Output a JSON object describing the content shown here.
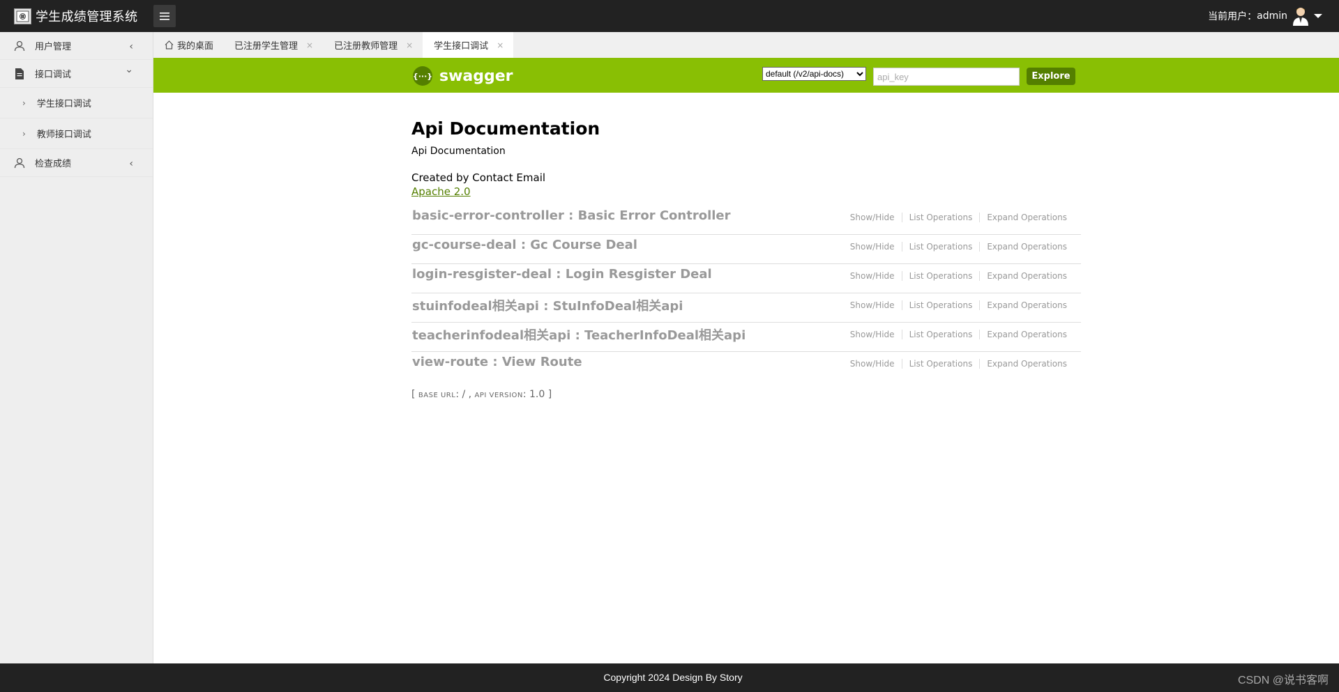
{
  "app": {
    "title": "学生成绩管理系统",
    "current_user_label": "当前用户：",
    "current_user": "admin"
  },
  "sidebar": {
    "items": [
      {
        "label": "用户管理",
        "icon": "user-icon",
        "chevron": "‹"
      },
      {
        "label": "接口调试",
        "icon": "document-icon",
        "chevron": "⌄",
        "children": [
          {
            "label": "学生接口调试"
          },
          {
            "label": "教师接口调试"
          }
        ]
      },
      {
        "label": "检查成绩",
        "icon": "user-icon",
        "chevron": "‹"
      }
    ]
  },
  "tabs": [
    {
      "label": "我的桌面",
      "icon": "home-icon"
    },
    {
      "label": "已注册学生管理",
      "close": "×"
    },
    {
      "label": "已注册教师管理",
      "close": "×"
    },
    {
      "label": "学生接口调试",
      "close": "×",
      "active": true
    }
  ],
  "swagger": {
    "logo_text": "swagger",
    "logo_glyph": "{···}",
    "select_value": "default (/v2/api-docs)",
    "api_key_placeholder": "api_key",
    "explore_label": "Explore",
    "brand_color": "#89bf04"
  },
  "doc": {
    "title": "Api Documentation",
    "description": "Api Documentation",
    "created_by": "Created by Contact Email",
    "license": "Apache 2.0"
  },
  "resources": [
    {
      "name": "basic-error-controller : Basic Error Controller"
    },
    {
      "name": "gc-course-deal : Gc Course Deal"
    },
    {
      "name": "login-resgister-deal : Login Resgister Deal"
    },
    {
      "name": "stuinfodeal相关api : StuInfoDeal相关api"
    },
    {
      "name": "teacherinfodeal相关api : TeacherInfoDeal相关api"
    },
    {
      "name": "view-route : View Route"
    }
  ],
  "resource_ops": {
    "show_hide": "Show/Hide",
    "list": "List Operations",
    "expand": "Expand Operations"
  },
  "base_info": {
    "open": "[ ",
    "base_url_label": "BASE URL",
    "base_url": ": / , ",
    "api_version_label": "API VERSION",
    "api_version": ": 1.0 ]"
  },
  "footer": {
    "copyright": "Copyright 2024 Design By Story",
    "watermark": "CSDN @说书客啊"
  }
}
